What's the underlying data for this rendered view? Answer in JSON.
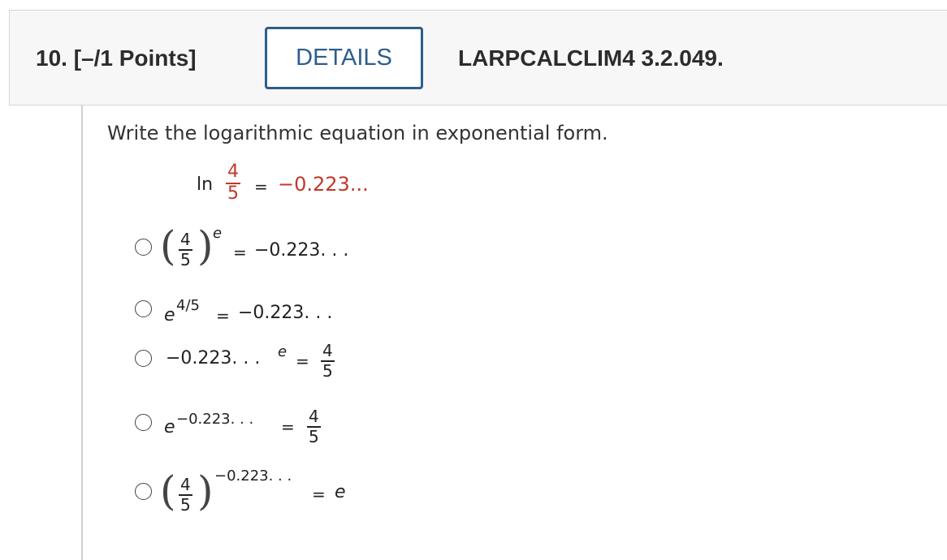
{
  "header": {
    "question_number": "10. [–/1 Points]",
    "details_label": "DETAILS",
    "reference": "LARPCALCLIM4 3.2.049."
  },
  "question": {
    "prompt": "Write the logarithmic equation in exponential form.",
    "equation": {
      "ln": "ln",
      "numerator": "4",
      "denominator": "5",
      "equals": "=",
      "value": "−0.223..."
    }
  },
  "options": [
    {
      "base_num": "4",
      "base_den": "5",
      "exponent": "e",
      "equals": "=",
      "rhs": "−0.223. . ."
    },
    {
      "base": "e",
      "exponent": "4/5",
      "equals": "=",
      "rhs": "−0.223. . ."
    },
    {
      "base": "−0.223. . .",
      "exponent": "e",
      "equals": "=",
      "rhs_num": "4",
      "rhs_den": "5"
    },
    {
      "base": "e",
      "exponent": "−0.223. . .",
      "equals": "=",
      "rhs_num": "4",
      "rhs_den": "5"
    },
    {
      "base_num": "4",
      "base_den": "5",
      "exponent": "−0.223. . .",
      "equals": "=",
      "rhs": "e"
    }
  ],
  "colors": {
    "accent": "#2d5d8e",
    "highlight": "#c0392b",
    "header_bg": "#f7f7f7"
  }
}
